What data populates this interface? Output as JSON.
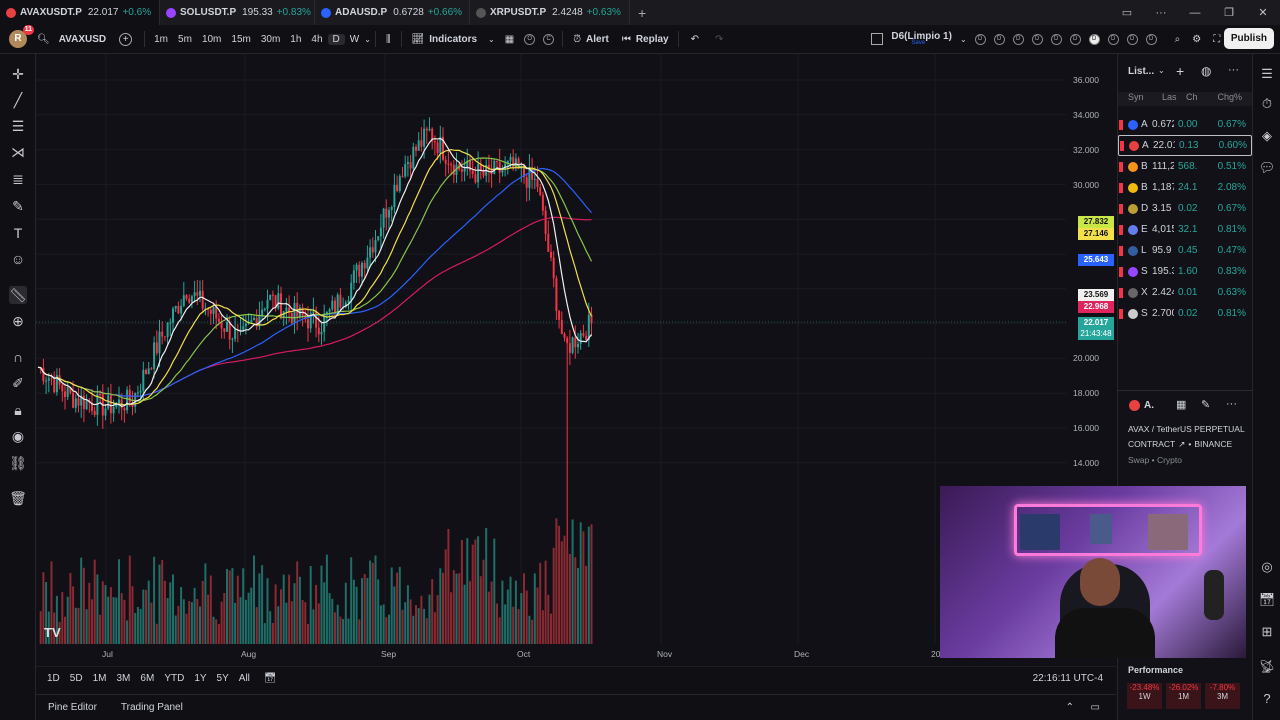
{
  "tabs": [
    {
      "symbol": "AVAXUSDT.P",
      "price": "22.017",
      "change": "+0.6%",
      "color": "#e84142"
    },
    {
      "symbol": "SOLUSDT.P",
      "price": "195.33",
      "change": "+0.83%",
      "color": "#9945ff"
    },
    {
      "symbol": "ADAUSD.P",
      "price": "0.6728",
      "change": "+0.66%",
      "color": "#2962ff"
    },
    {
      "symbol": "XRPUSDT.P",
      "price": "2.4248",
      "change": "+0.63%",
      "color": "#555"
    }
  ],
  "toolbar": {
    "symbol": "AVAXUSD",
    "intervals": [
      "1m",
      "5m",
      "10m",
      "15m",
      "30m",
      "1h",
      "4h",
      "D",
      "W"
    ],
    "selected_interval": "D",
    "indicators_label": "Indicators",
    "alert_label": "Alert",
    "replay_label": "Replay",
    "layout_name": "D6(Limpio 1)",
    "layout_sub": "Save",
    "publish_label": "Publish",
    "avatar": "R",
    "badge": "11"
  },
  "chart": {
    "price_labels": [
      "36.000",
      "34.000",
      "32.000",
      "30.000",
      "27.832",
      "27.146",
      "25.643",
      "23.569",
      "22.968",
      "22.017",
      "21:43:48",
      "20.000",
      "18.000",
      "16.000",
      "14.000"
    ],
    "time_labels": [
      "Jul",
      "Aug",
      "Sep",
      "Oct",
      "Nov",
      "Dec",
      "20"
    ],
    "current_price": "22.017",
    "countdown": "21:43:48"
  },
  "bottom": {
    "ranges": [
      "1D",
      "5D",
      "1M",
      "3M",
      "6M",
      "YTD",
      "1Y",
      "5Y",
      "All"
    ],
    "clock": "22:16:11 UTC-4",
    "pine_editor": "Pine Editor",
    "trading_panel": "Trading Panel"
  },
  "watchlist": {
    "title": "List...",
    "headers": [
      "Syn",
      "Las",
      "Ch",
      "Chg%"
    ],
    "rows": [
      {
        "sym": "A",
        "last": "0.672",
        "ch": "0.00",
        "chp": "0.67%",
        "color": "#2962ff"
      },
      {
        "sym": "A",
        "last": "22.01",
        "ch": "0.13",
        "chp": "0.60%",
        "color": "#e84142"
      },
      {
        "sym": "B",
        "last": "111,2",
        "ch": "568.",
        "chp": "0.51%",
        "color": "#f7931a"
      },
      {
        "sym": "B",
        "last": "1,187",
        "ch": "24.1",
        "chp": "2.08%",
        "color": "#f0b90b"
      },
      {
        "sym": "D",
        "last": "3.15",
        "ch": "0.02",
        "chp": "0.67%",
        "color": "#ba9f33"
      },
      {
        "sym": "E",
        "last": "4,015",
        "ch": "32.1",
        "chp": "0.81%",
        "color": "#627eea"
      },
      {
        "sym": "L",
        "last": "95.9",
        "ch": "0.45",
        "chp": "0.47%",
        "color": "#345d9d"
      },
      {
        "sym": "S",
        "last": "195.3",
        "ch": "1.60",
        "chp": "0.83%",
        "color": "#9945ff"
      },
      {
        "sym": "X",
        "last": "2.424",
        "ch": "0.01",
        "chp": "0.63%",
        "color": "#666"
      },
      {
        "sym": "S",
        "last": "2.700",
        "ch": "0.02",
        "chp": "0.81%",
        "color": "#cccccc"
      }
    ]
  },
  "details": {
    "short": "A.",
    "name": "AVAX / TetherUS PERPETUAL",
    "contract": "CONTRACT",
    "exchange": "BINANCE",
    "type": "Swap • Crypto",
    "performance_label": "Performance",
    "perf": [
      {
        "val": "-23.48%",
        "period": "1W"
      },
      {
        "val": "-26.02%",
        "period": "1M"
      },
      {
        "val": "-7.80%",
        "period": "3M"
      }
    ]
  },
  "colors": {
    "up": "#26a69a",
    "down": "#f23645",
    "accent": "#2962ff"
  }
}
